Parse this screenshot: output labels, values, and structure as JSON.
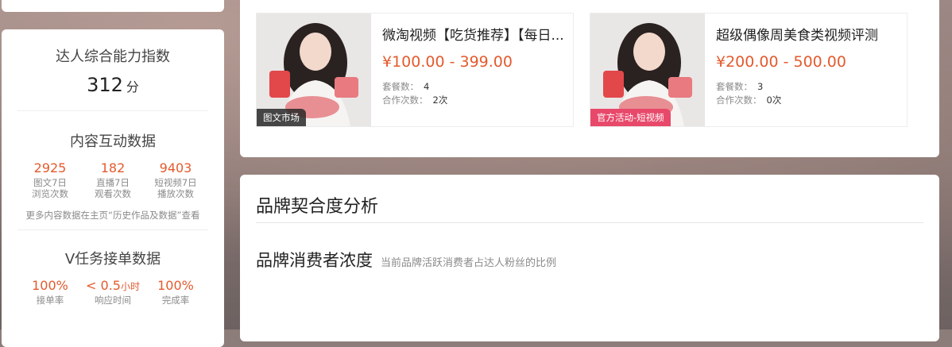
{
  "left": {
    "ability_title": "达人综合能力指数",
    "score": "312",
    "score_unit": "分",
    "content": {
      "title": "内容互动数据",
      "stats": [
        {
          "value": "2925",
          "line1": "图文7日",
          "line2": "浏览次数"
        },
        {
          "value": "182",
          "line1": "直播7日",
          "line2": "观看次数"
        },
        {
          "value": "9403",
          "line1": "短视频7日",
          "line2": "播放次数"
        }
      ],
      "note": "更多内容数据在主页“历史作品及数据”查看"
    },
    "task": {
      "title": "V任务接单数据",
      "stats": [
        {
          "value": "100%",
          "unit": "",
          "label": "接单率"
        },
        {
          "value": "< 0.5",
          "unit": "小时",
          "label": "响应时间"
        },
        {
          "value": "100%",
          "unit": "",
          "label": "完成率"
        }
      ]
    }
  },
  "products": [
    {
      "name": "微淘视频【吃货推荐】【每日...",
      "price": "¥100.00 - 399.00",
      "packages_label": "套餐数：",
      "packages": "4",
      "coop_label": "合作次数：",
      "coop": "2次",
      "tag": "图文市场",
      "tag_color": "#3a3a3a"
    },
    {
      "name": "超级偶像周美食类视频评测",
      "price": "¥200.00 - 500.00",
      "packages_label": "套餐数：",
      "packages": "3",
      "coop_label": "合作次数：",
      "coop": "0次",
      "tag": "官方活动-短视频",
      "tag_color": "#e8496a"
    }
  ],
  "brand": {
    "title": "品牌契合度分析",
    "sub_title": "品牌消费者浓度",
    "sub_desc": "当前品牌活跃消费者占达人粉丝的比例"
  }
}
